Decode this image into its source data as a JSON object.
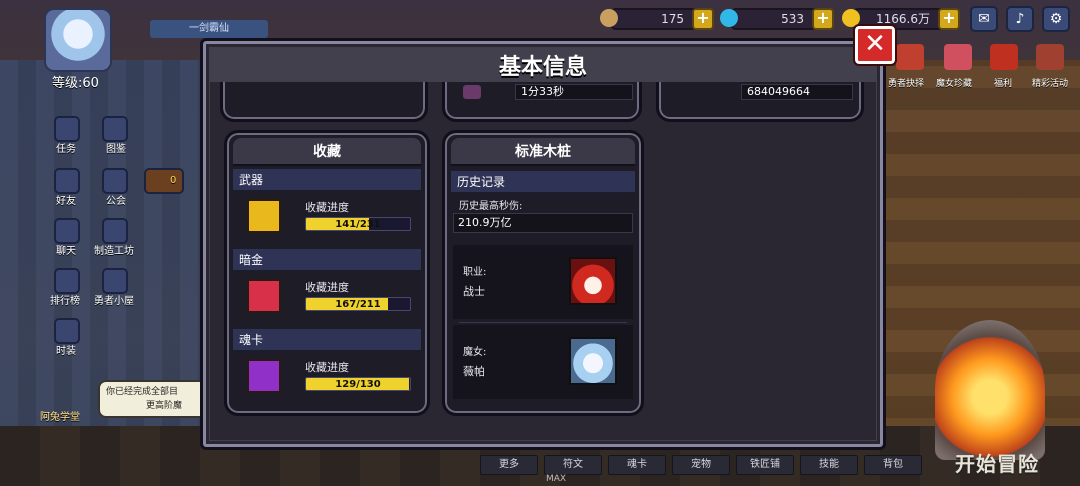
{
  "hud": {
    "level_label": "等级:60",
    "player_name": "一剑霸仙",
    "resources": [
      {
        "value": "175",
        "color": "#c9a060"
      },
      {
        "value": "533",
        "color": "#2fb8e8"
      },
      {
        "value": "1166.6万",
        "color": "#f0c020"
      }
    ],
    "right_menu": [
      "勇者抉择",
      "魔女珍藏",
      "福利",
      "精彩活动"
    ],
    "left_menu": [
      "任务",
      "图鉴",
      "好友",
      "公会",
      "聊天",
      "制造工坊",
      "排行榜",
      "勇者小屋",
      "时装"
    ],
    "weapon_count": "0",
    "notice_line1": "你已经完成全部目",
    "notice_line2": "更高阶魔",
    "notice_caption": "阿兔学堂",
    "bottom_buttons": [
      "更多",
      "符文",
      "魂卡",
      "宠物",
      "铁匠铺",
      "技能",
      "背包"
    ],
    "max_label": "MAX",
    "start_button": "开始冒险"
  },
  "modal": {
    "title": "基本信息",
    "top_fields": {
      "middle_value": "1分33秒",
      "right_value": "684049664"
    },
    "collection": {
      "title": "收藏",
      "sections": [
        {
          "name": "武器",
          "progress_label": "收藏进度",
          "progress_text": "141/231",
          "progress_fraction": 0.61,
          "icon_color": "#e8b81c"
        },
        {
          "name": "暗金",
          "progress_label": "收藏进度",
          "progress_text": "167/211",
          "progress_fraction": 0.79,
          "icon_color": "#d83048"
        },
        {
          "name": "魂卡",
          "progress_label": "收藏进度",
          "progress_text": "129/130",
          "progress_fraction": 0.99,
          "icon_color": "#9030c8"
        }
      ]
    },
    "dummy": {
      "title": "标准木桩",
      "history_header": "历史记录",
      "max_dps_label": "历史最高秒伤:",
      "max_dps_value": "210.9万亿",
      "job_label": "职业:",
      "job_value": "战士",
      "witch_label": "魔女:",
      "witch_value": "薇帕"
    }
  }
}
